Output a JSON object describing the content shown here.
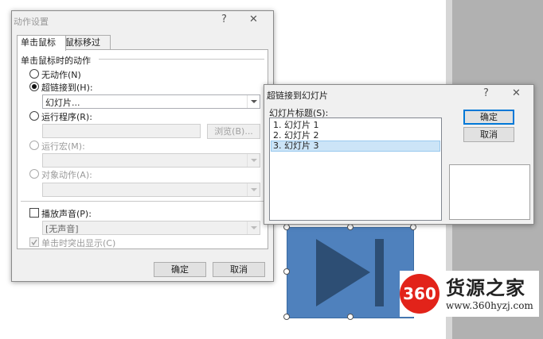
{
  "dialog_action": {
    "title": "动作设置",
    "help": "?",
    "close": "✕",
    "tabs": [
      "单击鼠标",
      "鼠标移过"
    ],
    "group_label": "单击鼠标时的动作",
    "no_action": "无动作(N)",
    "hyperlink": "超链接到(H):",
    "hyperlink_value": "幻灯片...",
    "run_program": "运行程序(R):",
    "browse": "浏览(B)...",
    "run_macro": "运行宏(M):",
    "object_action": "对象动作(A):",
    "play_sound": "播放声音(P):",
    "sound_value": "[无声音]",
    "highlight": "单击时突出显示(C)",
    "ok": "确定",
    "cancel": "取消"
  },
  "dialog_link": {
    "title": "超链接到幻灯片",
    "help": "?",
    "close": "✕",
    "list_label": "幻灯片标题(S):",
    "items": [
      "1. 幻灯片 1",
      "2. 幻灯片 2",
      "3. 幻灯片 3"
    ],
    "selected_index": 2,
    "ok": "确定",
    "cancel": "取消"
  },
  "watermark": {
    "badge": "360",
    "name": "货源之家",
    "url": "www.360hyzj.com"
  },
  "colors": {
    "shape_fill": "#4f81bd",
    "shape_icon": "#2d4e74",
    "selection": "#cce4f7",
    "badge": "#e2231a"
  },
  "icons": {
    "next_slide_shape": "play-next-icon"
  }
}
